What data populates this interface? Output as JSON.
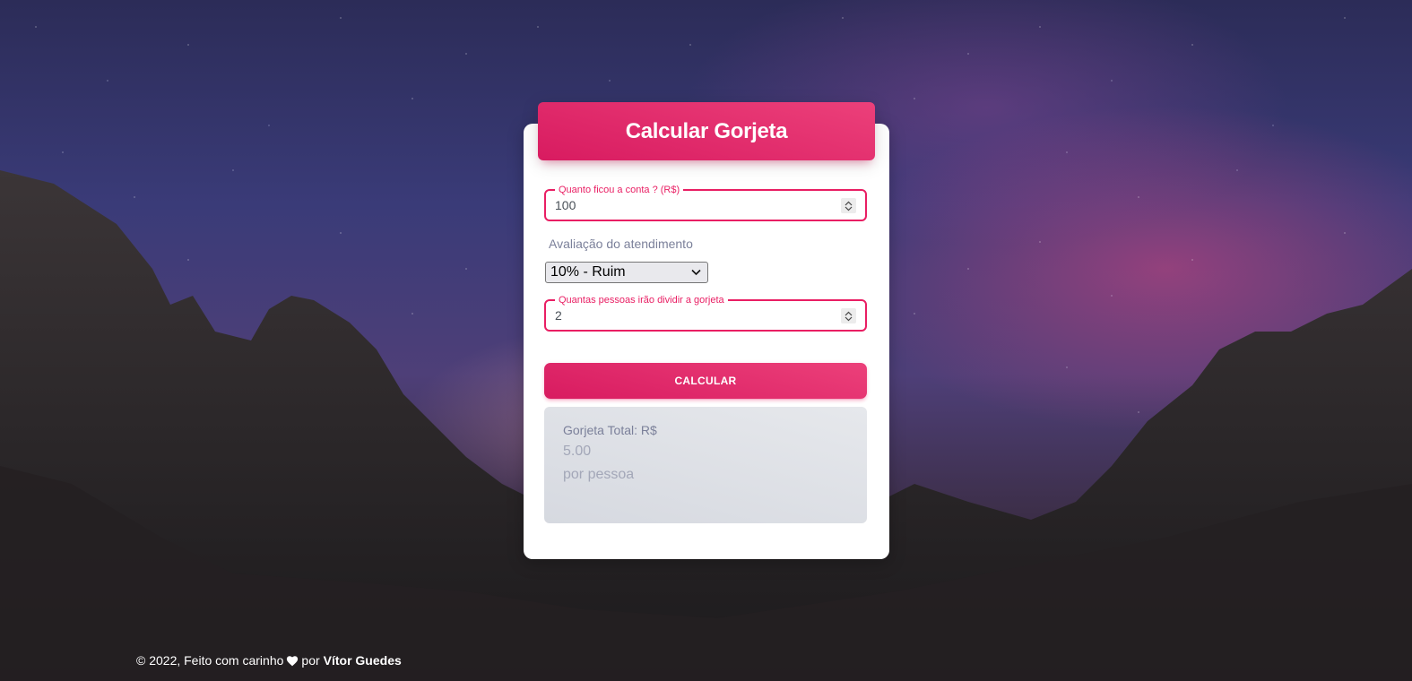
{
  "card": {
    "title": "Calcular Gorjeta"
  },
  "form": {
    "bill": {
      "label": "Quanto ficou a conta ? (R$)",
      "value": "100"
    },
    "rating": {
      "label": "Avaliação do atendimento",
      "selected": "10% - Ruim"
    },
    "people": {
      "label": "Quantas pessoas irão dividir a gorjeta",
      "value": "2"
    },
    "submit_label": "CALCULAR"
  },
  "result": {
    "label": "Gorjeta Total: R$",
    "value": "5.00",
    "unit": "por pessoa"
  },
  "footer": {
    "text": "© 2022, Feito com carinho",
    "icon": "heart-icon",
    "por": "por",
    "author": "Vítor Guedes"
  },
  "colors": {
    "accent": "#e91e63",
    "accent_light": "#ec407a",
    "accent_dark": "#d81b60",
    "muted_text": "#7b809a",
    "result_bg": "#e0e3e8"
  }
}
